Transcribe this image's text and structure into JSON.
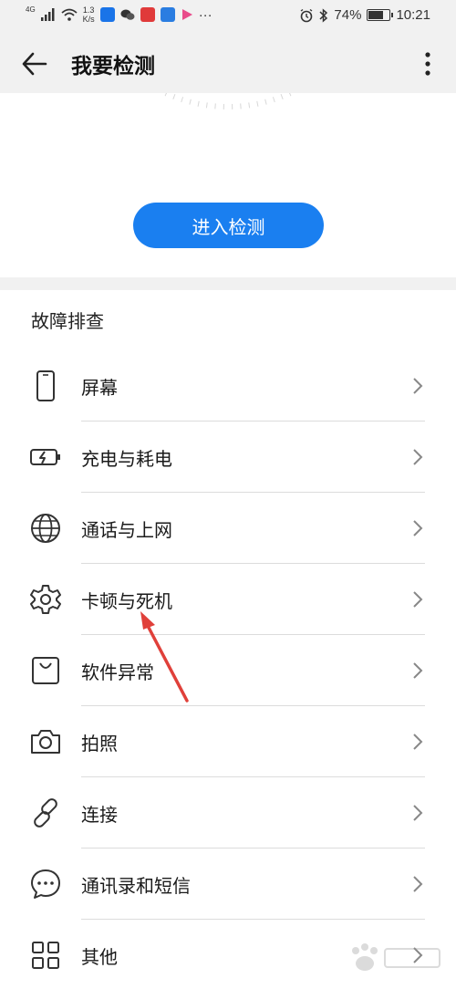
{
  "statusbar": {
    "net_type": "4G",
    "speed": "1.3",
    "speed_unit": "K/s",
    "more": "···",
    "battery": "74%",
    "time": "10:21",
    "battery_level": 0.74
  },
  "header": {
    "title": "我要检测"
  },
  "hero": {
    "start_label": "进入检测"
  },
  "section": {
    "title": "故障排查"
  },
  "items": [
    {
      "label": "屏幕",
      "icon": "phone-icon"
    },
    {
      "label": "充电与耗电",
      "icon": "battery-charging-icon"
    },
    {
      "label": "通话与上网",
      "icon": "globe-icon"
    },
    {
      "label": "卡顿与死机",
      "icon": "gear-icon"
    },
    {
      "label": "软件异常",
      "icon": "shopping-bag-icon"
    },
    {
      "label": "拍照",
      "icon": "camera-icon"
    },
    {
      "label": "连接",
      "icon": "link-icon"
    },
    {
      "label": "通讯录和短信",
      "icon": "message-icon"
    },
    {
      "label": "其他",
      "icon": "grid-icon"
    }
  ],
  "colors": {
    "accent": "#1a7ff0",
    "annotation_arrow": "#e0403a"
  }
}
